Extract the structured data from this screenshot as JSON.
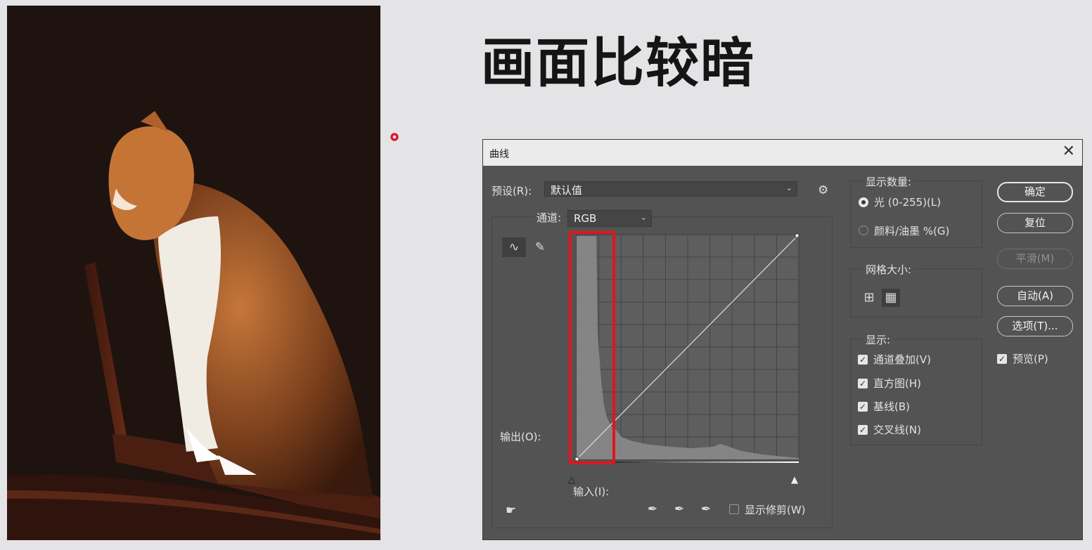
{
  "slide": {
    "title": "画面比较暗"
  },
  "dialog": {
    "title": "曲线",
    "close_icon": "close-icon",
    "preset": {
      "label": "预设(R):",
      "value": "默认值"
    },
    "channel": {
      "label": "通道:",
      "value": "RGB"
    },
    "output_label": "输出(O):",
    "input_label": "输入(I):",
    "show_clipping": {
      "label": "显示修剪(W)",
      "checked": false
    },
    "display_amount": {
      "legend": "显示数量:",
      "options": [
        {
          "label": "光 (0-255)(L)",
          "selected": true
        },
        {
          "label": "颜料/油墨 %(G)",
          "selected": false
        }
      ]
    },
    "grid_size": {
      "legend": "网格大小:",
      "selected": "detailed"
    },
    "show": {
      "legend": "显示:",
      "items": [
        {
          "label": "通道叠加(V)",
          "checked": true
        },
        {
          "label": "直方图(H)",
          "checked": true
        },
        {
          "label": "基线(B)",
          "checked": true
        },
        {
          "label": "交叉线(N)",
          "checked": true
        }
      ]
    },
    "buttons": {
      "ok": "确定",
      "reset": "复位",
      "smooth": "平滑(M)",
      "auto": "自动(A)",
      "options": "选项(T)..."
    },
    "preview": {
      "label": "预览(P)",
      "checked": true
    },
    "colors": {
      "highlight_box": "#e0151f",
      "panel": "#535353"
    }
  }
}
